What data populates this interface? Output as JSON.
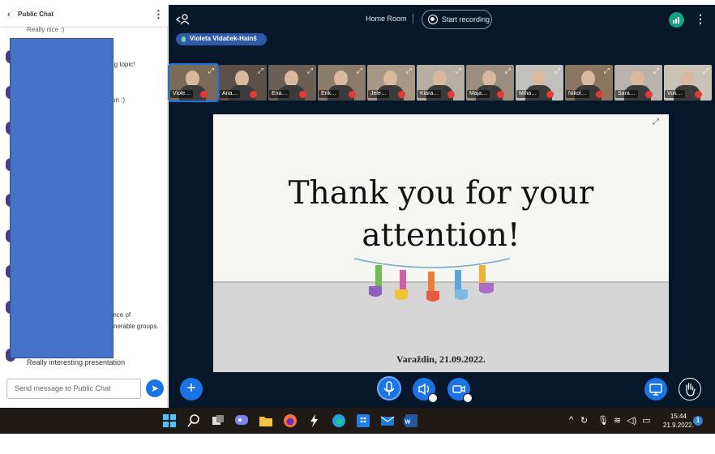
{
  "chat": {
    "back_icon": "chevron-left-icon",
    "title": "Public Chat",
    "partial_top": "Really nice :)",
    "fragments": [
      "ding topic!",
      "on :)",
      "rtance of",
      "nerable groups."
    ],
    "last_message": "Really interesting presentation",
    "input_placeholder": "Send message to Public Chat",
    "send_icon": "send-icon",
    "redaction_color": "#4472c4"
  },
  "meeting": {
    "room_title": "Home Room",
    "start_recording": "Start recording",
    "presenter": "Violeta Vidaček-Hainš",
    "accent": "#1b74e4",
    "participants": [
      {
        "name": "Viole…",
        "bg": "#7a6a5a"
      },
      {
        "name": "Ana…",
        "bg": "#5c5048"
      },
      {
        "name": "Ena…",
        "bg": "#6b5f55"
      },
      {
        "name": "Erik…",
        "bg": "#8c7b6b"
      },
      {
        "name": "Jele…",
        "bg": "#a79886"
      },
      {
        "name": "Klara…",
        "bg": "#b7aea2"
      },
      {
        "name": "Maja…",
        "bg": "#9c8e7e"
      },
      {
        "name": "Miha…",
        "bg": "#c2c0bd"
      },
      {
        "name": "Nikol…",
        "bg": "#8a7560"
      },
      {
        "name": "Sara…",
        "bg": "#b9b3ad"
      },
      {
        "name": "Vuk…",
        "bg": "#c9c2b8"
      }
    ],
    "slide": {
      "title_line1": "Thank you for your",
      "title_line2": "attention!",
      "footer": "Varaždin, 21.09.2022."
    }
  },
  "taskbar": {
    "icons": [
      "windows-start-icon",
      "search-icon",
      "task-view-icon",
      "chat-icon",
      "file-explorer-icon",
      "firefox-icon",
      "lightning-icon",
      "edge-icon",
      "dropbox-icon",
      "mail-icon",
      "word-icon"
    ],
    "time": "15:44",
    "date": "21.9.2022.",
    "notification_count": "1"
  }
}
